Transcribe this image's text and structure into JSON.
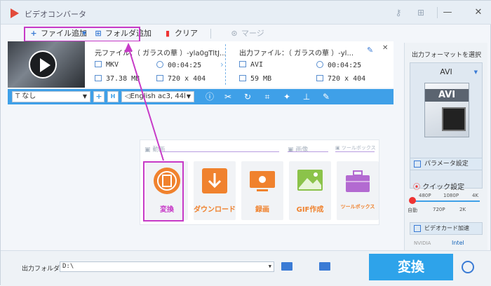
{
  "window": {
    "title": "ビデオコンバータ"
  },
  "toolbar": {
    "add_file": "ファイル追加",
    "add_folder": "フォルダ追加",
    "clear": "クリア",
    "merge": "マージ"
  },
  "source": {
    "title": "元ファイル：（ ガラスの華 ）-yla0gTltJ...",
    "format": "MKV",
    "duration": "00:04:25",
    "size": "37.38 MB",
    "resolution": "720 x 404"
  },
  "output": {
    "title": "出力ファイル：（ ガラスの華 ）-yl...",
    "format": "AVI",
    "duration": "00:04:25",
    "size": "59 MB",
    "resolution": "720 x 404"
  },
  "editbar": {
    "subtitle": "なし",
    "audio": "English ac3, 44l"
  },
  "main": {
    "section_video": "動画",
    "section_image": "画像",
    "section_toolbox": "ツールボックス",
    "cards": [
      {
        "label": "変換",
        "color": "#f0822e"
      },
      {
        "label": "ダウンロード",
        "color": "#f0822e"
      },
      {
        "label": "録画",
        "color": "#f0822e"
      },
      {
        "label": "GIF作成",
        "color": "#f0822e"
      },
      {
        "label": "ツールボックス",
        "color": "#b36ad1"
      }
    ]
  },
  "right": {
    "title": "出力フォーマットを選択",
    "format": "AVI",
    "param_btn": "パラメータ設定",
    "quick": "クイック設定",
    "ticks_top": [
      "480P",
      "1080P",
      "4K"
    ],
    "ticks_bottom": [
      "自動",
      "720P",
      "2K"
    ],
    "hw_btn": "ビデオカード加速",
    "gpu_nvidia": "NVIDIA",
    "gpu_intel": "Intel"
  },
  "bottom": {
    "out_label": "出力フォルダ：",
    "out_path": "D:\\",
    "convert": "変換"
  },
  "colors": {
    "accent": "#2ea3ea",
    "highlight": "#c73ac7",
    "orange": "#f0822e"
  }
}
